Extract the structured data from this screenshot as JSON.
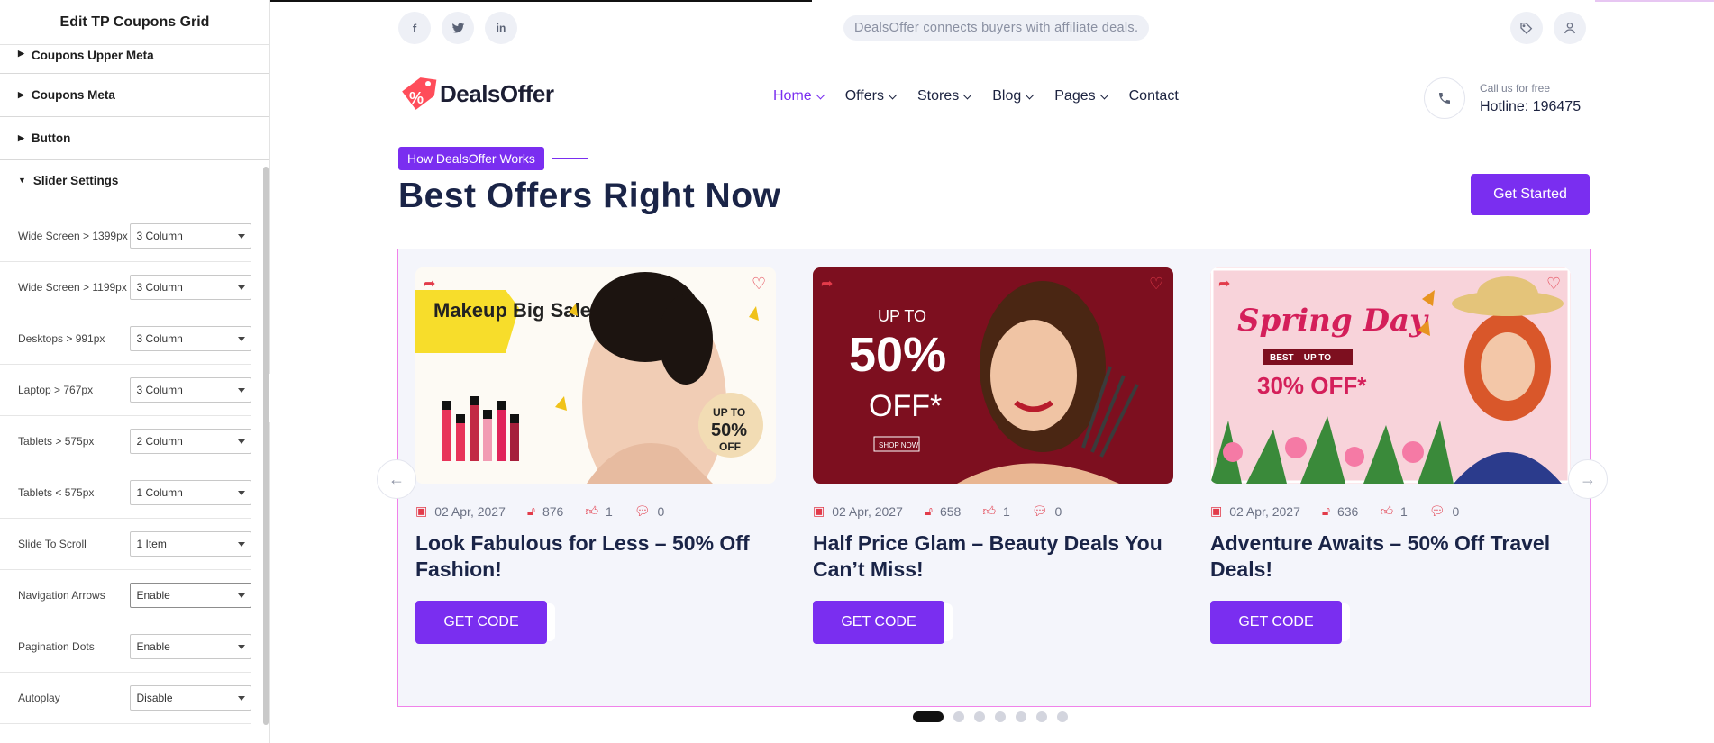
{
  "panel": {
    "title": "Edit TP Coupons Grid",
    "sections": [
      {
        "label": "Coupons Upper Meta",
        "expanded": false
      },
      {
        "label": "Coupons Meta",
        "expanded": false
      },
      {
        "label": "Button",
        "expanded": false
      },
      {
        "label": "Slider Settings",
        "expanded": true
      }
    ],
    "controls": [
      {
        "label": "Wide Screen > 1399px",
        "value": "3 Column"
      },
      {
        "label": "Wide Screen > 1199px",
        "value": "3 Column"
      },
      {
        "label": "Desktops > 991px",
        "value": "3 Column"
      },
      {
        "label": "Laptop > 767px",
        "value": "3 Column"
      },
      {
        "label": "Tablets > 575px",
        "value": "2 Column"
      },
      {
        "label": "Tablets < 575px",
        "value": "1 Column"
      },
      {
        "label": "Slide To Scroll",
        "value": "1 Item"
      },
      {
        "label": "Navigation Arrows",
        "value": "Enable"
      },
      {
        "label": "Pagination Dots",
        "value": "Enable"
      },
      {
        "label": "Autoplay",
        "value": "Disable"
      }
    ]
  },
  "site": {
    "tagline": "DealsOffer connects buyers with affiliate deals.",
    "social_icons": [
      "facebook-icon",
      "twitter-icon",
      "linkedin-icon"
    ],
    "logo_text": "DealsOffer",
    "nav": [
      {
        "label": "Home",
        "active": true,
        "dropdown": true
      },
      {
        "label": "Offers",
        "active": false,
        "dropdown": true
      },
      {
        "label": "Stores",
        "active": false,
        "dropdown": true
      },
      {
        "label": "Blog",
        "active": false,
        "dropdown": true
      },
      {
        "label": "Pages",
        "active": false,
        "dropdown": true
      },
      {
        "label": "Contact",
        "active": false,
        "dropdown": false
      }
    ],
    "call": {
      "small": "Call us for free",
      "big": "Hotline: 196475"
    },
    "section_tag": "How DealsOffer Works",
    "heading": "Best Offers Right Now",
    "cta": "Get Started",
    "colors": {
      "accent": "#7a2ef0",
      "danger": "#e23b4a",
      "heading": "#1a2447"
    },
    "cards": [
      {
        "date": "02 Apr, 2027",
        "views": "876",
        "likes": "1",
        "comments": "0",
        "title": "Look Fabulous for Less – 50% Off Fashion!",
        "button": "GET CODE",
        "image": {
          "banner": "Makeup Big Sale",
          "badge_top": "UP TO",
          "badge_pct": "50%",
          "badge_bottom": "OFF"
        }
      },
      {
        "date": "02 Apr, 2027",
        "views": "658",
        "likes": "1",
        "comments": "0",
        "title": "Half Price Glam – Beauty Deals You Can’t Miss!",
        "button": "GET CODE",
        "image": {
          "up": "UP TO",
          "pct": "50%",
          "off": "OFF*",
          "small": "SHOP NOW"
        }
      },
      {
        "date": "02 Apr, 2027",
        "views": "636",
        "likes": "1",
        "comments": "0",
        "title": "Adventure Awaits – 50% Off Travel Deals!",
        "button": "GET CODE",
        "image": {
          "script": "Spring Day",
          "ribbon": "BEST – UP TO",
          "off": "30% OFF*"
        }
      }
    ],
    "pagination": {
      "count": 7,
      "active": 0
    }
  }
}
